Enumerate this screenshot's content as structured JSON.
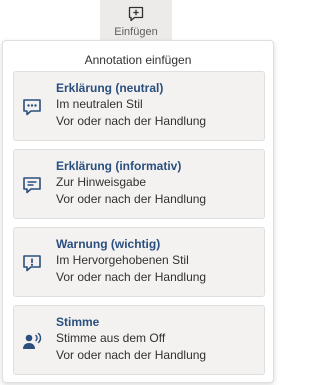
{
  "toolbar": {
    "insert_label": "Einfügen",
    "insert_icon": "comment-add-icon"
  },
  "panel": {
    "title": "Annotation einfügen",
    "items": [
      {
        "icon": "comment-dots-icon",
        "heading": "Erklärung (neutral)",
        "line1": "Im neutralen Stil",
        "line2": "Vor oder nach der Handlung"
      },
      {
        "icon": "comment-lines-icon",
        "heading": "Erklärung (informativ)",
        "line1": "Zur Hinweisgabe",
        "line2": "Vor oder nach der Handlung"
      },
      {
        "icon": "comment-alert-icon",
        "heading": "Warnung (wichtig)",
        "line1": "Im Hervorgehobenen Stil",
        "line2": "Vor oder nach der Handlung"
      },
      {
        "icon": "person-voice-icon",
        "heading": "Stimme",
        "line1": "Stimme aus dem Off",
        "line2": "Vor oder nach der Handlung"
      }
    ]
  },
  "colors": {
    "accent": "#2b4f7e",
    "card_bg": "#f3f2f1",
    "toolbar_bg": "#edebe9"
  }
}
